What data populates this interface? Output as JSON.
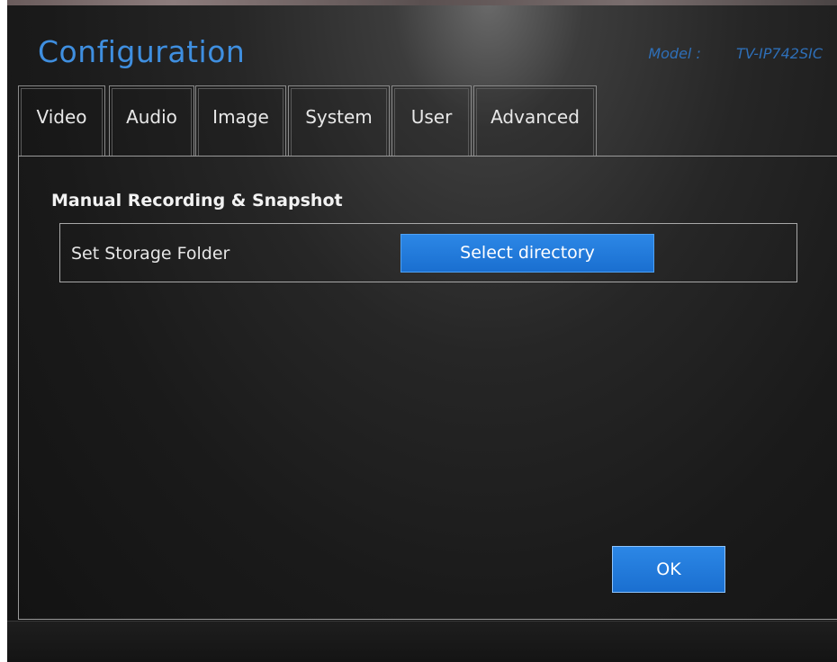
{
  "header": {
    "title": "Configuration",
    "model_label": "Model :",
    "model_value": "TV-IP742SIC"
  },
  "tabs": [
    {
      "label": "Video"
    },
    {
      "label": "Audio"
    },
    {
      "label": "Image"
    },
    {
      "label": "System"
    },
    {
      "label": "User"
    },
    {
      "label": "Advanced"
    }
  ],
  "section": {
    "title": "Manual Recording & Snapshot",
    "rows": [
      {
        "label": "Set Storage Folder",
        "button_label": "Select directory"
      }
    ]
  },
  "footer": {
    "ok_label": "OK"
  },
  "colors": {
    "accent": "#1e78dc",
    "title": "#3f8fe0",
    "model": "#2e6fb8"
  }
}
